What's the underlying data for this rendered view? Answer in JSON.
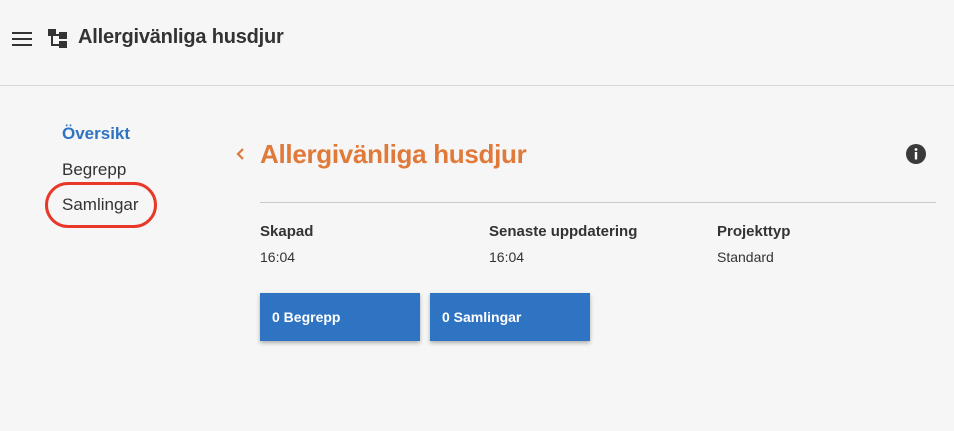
{
  "header": {
    "menu_icon": "hamburger-icon",
    "app_icon": "hierarchy-icon",
    "title": "Allergivänliga husdjur"
  },
  "sidebar": {
    "items": [
      {
        "label": "Översikt",
        "active": true
      },
      {
        "label": "Begrepp",
        "active": false
      },
      {
        "label": "Samlingar",
        "active": false,
        "highlighted": true
      }
    ],
    "highlight_color": "#e8382a"
  },
  "main": {
    "back_icon": "chevron-left-icon",
    "title": "Allergivänliga husdjur",
    "title_color": "#e07a3a",
    "info_icon": "info-icon",
    "meta": [
      {
        "label": "Skapad",
        "value": "16:04"
      },
      {
        "label": "Senaste uppdatering",
        "value": "16:04"
      },
      {
        "label": "Projekttyp",
        "value": "Standard"
      }
    ],
    "buttons": [
      {
        "label": "0 Begrepp"
      },
      {
        "label": "0 Samlingar"
      }
    ],
    "accent_color": "#2f73c3"
  }
}
